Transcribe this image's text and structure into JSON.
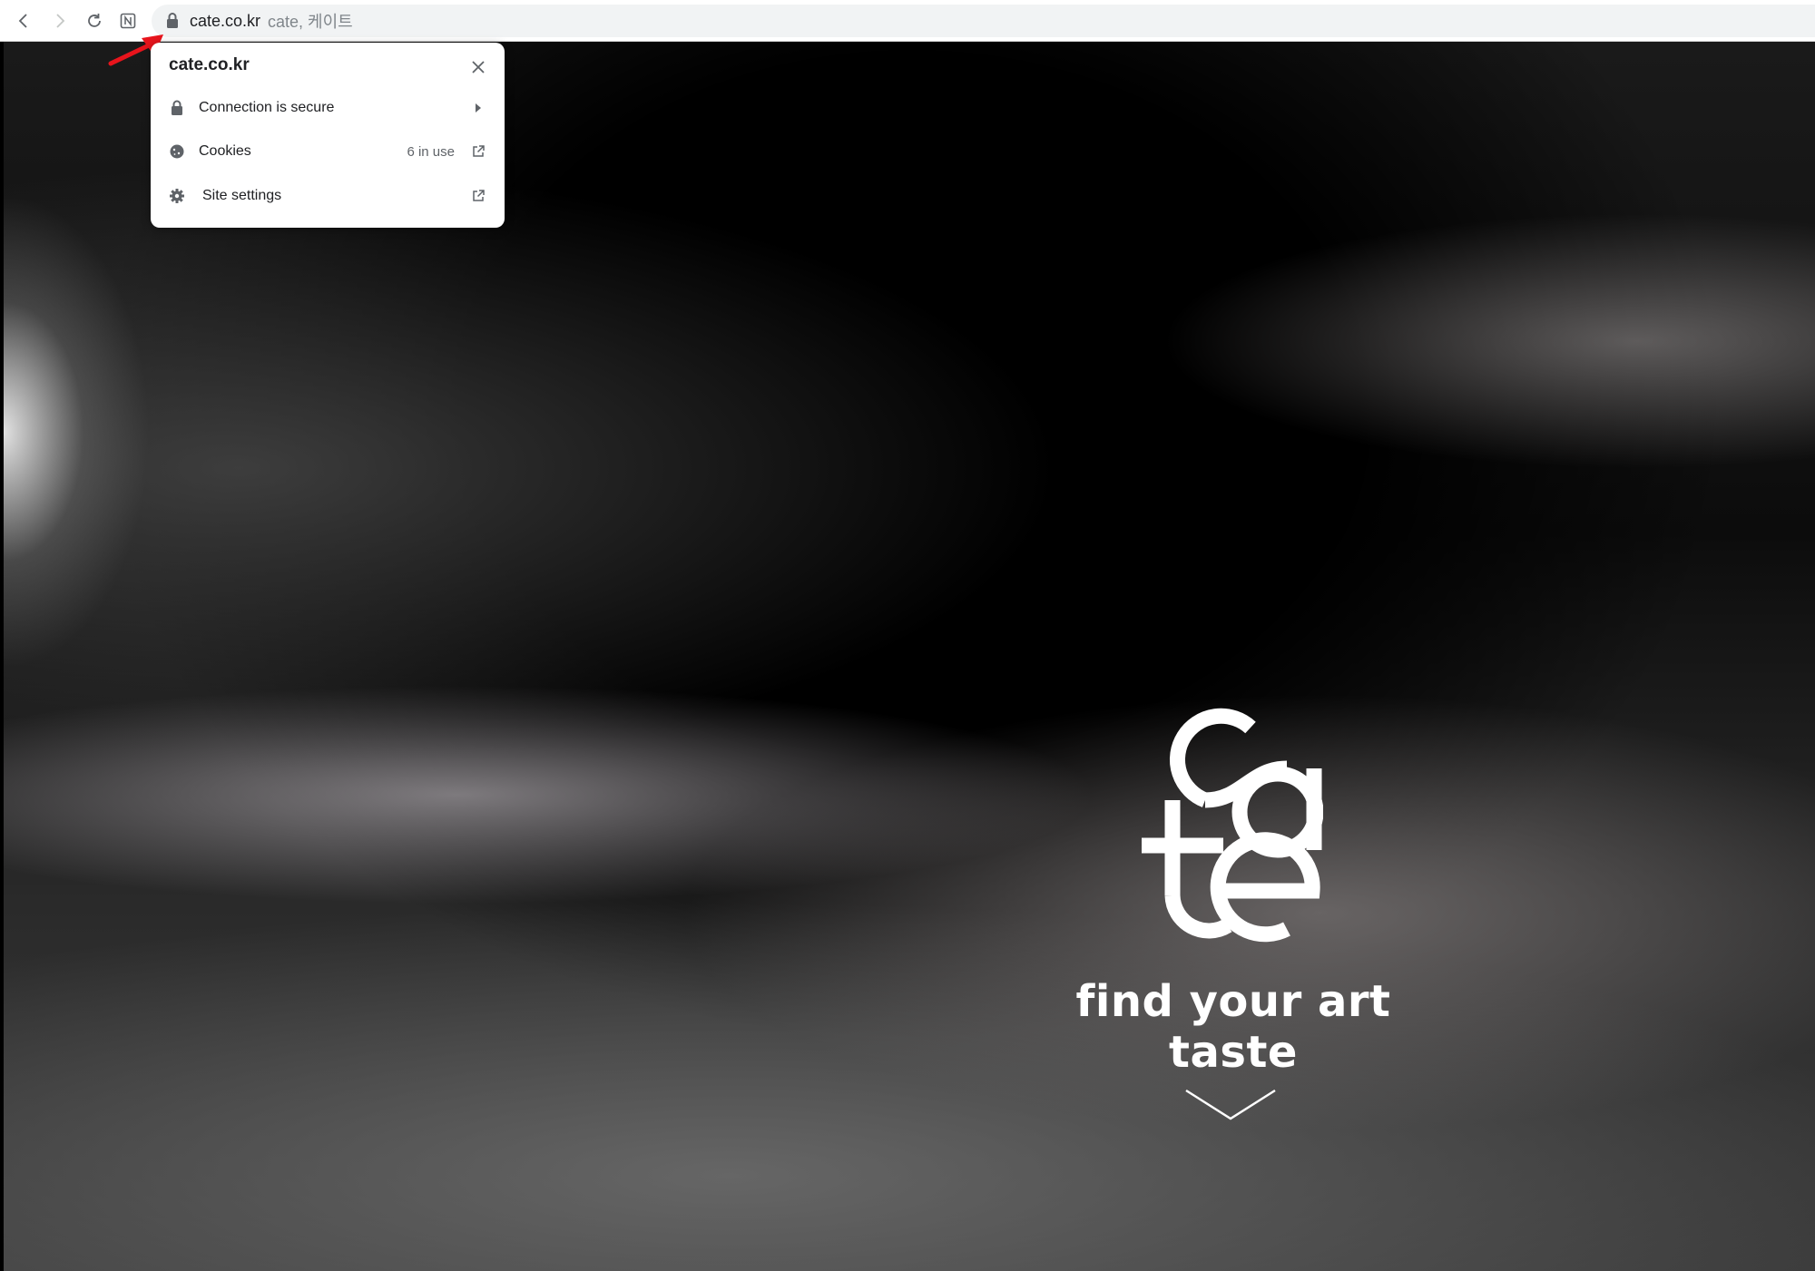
{
  "browser": {
    "address_domain": "cate.co.kr",
    "address_title": "cate, 케이트"
  },
  "site_info_popup": {
    "title": "cate.co.kr",
    "rows": [
      {
        "label": "Connection is secure",
        "icon": "lock-icon",
        "end_icon": "arrow-right-icon"
      },
      {
        "label": "Cookies",
        "value": "6 in use",
        "icon": "cookie-icon",
        "end_icon": "external-link-icon"
      },
      {
        "label": "Site settings",
        "icon": "gear-icon",
        "end_icon": "external-link-icon"
      }
    ]
  },
  "page": {
    "logo_text": "cate",
    "tagline": "find your art taste"
  },
  "colors": {
    "annotation_arrow": "#e8141c",
    "popup_bg": "#ffffff",
    "hero_text": "#ffffff"
  }
}
